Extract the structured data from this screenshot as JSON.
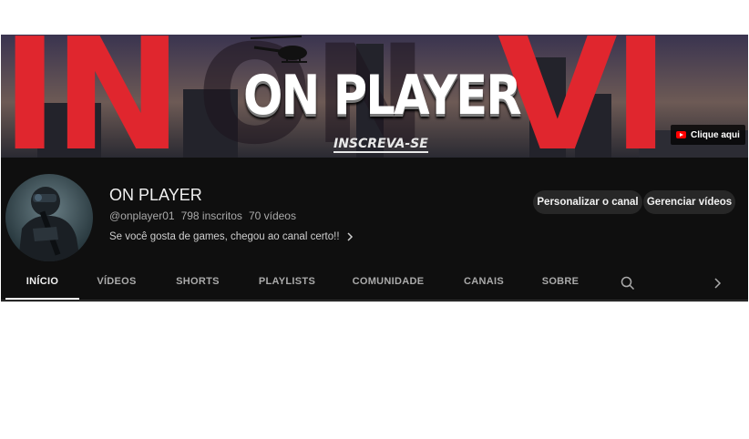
{
  "banner": {
    "title": "ON PLAYER",
    "subtitle": "INSCREVA-SE",
    "link_label": "Clique aqui",
    "accent_color": "#e0262e"
  },
  "channel": {
    "name": "ON PLAYER",
    "handle": "@onplayer01",
    "subscribers": "798 inscritos",
    "videos": "70 vídeos",
    "description": "Se você gosta de games, chegou ao canal certo!!"
  },
  "actions": {
    "customize_label": "Personalizar o canal",
    "manage_label": "Gerenciar vídeos"
  },
  "tabs": [
    {
      "label": "INÍCIO",
      "active": true
    },
    {
      "label": "VÍDEOS",
      "active": false
    },
    {
      "label": "SHORTS",
      "active": false
    },
    {
      "label": "PLAYLISTS",
      "active": false
    },
    {
      "label": "COMUNIDADE",
      "active": false
    },
    {
      "label": "CANAIS",
      "active": false
    },
    {
      "label": "SOBRE",
      "active": false
    }
  ],
  "icons": {
    "search": "search-icon",
    "next": "chevron-right-icon",
    "more": "chevron-right-icon"
  }
}
